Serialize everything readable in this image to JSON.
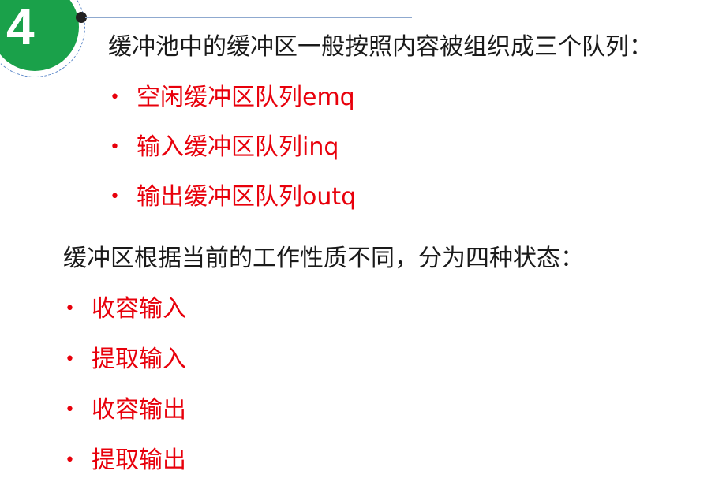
{
  "badge": {
    "number": "4"
  },
  "intro": "缓冲池中的缓冲区一般按照内容被组织成三个队列：",
  "queues": [
    {
      "label": "空闲缓冲区队列emq"
    },
    {
      "label": "输入缓冲区队列inq"
    },
    {
      "label": "输出缓冲区队列outq"
    }
  ],
  "states_intro": "缓冲区根据当前的工作性质不同，分为四种状态：",
  "states": [
    {
      "label": "收容输入"
    },
    {
      "label": "提取输入"
    },
    {
      "label": "收容输出"
    },
    {
      "label": "提取输出"
    }
  ],
  "colors": {
    "badge": "#1aa14a",
    "highlight": "#e8000b",
    "text": "#1a1a1a"
  }
}
